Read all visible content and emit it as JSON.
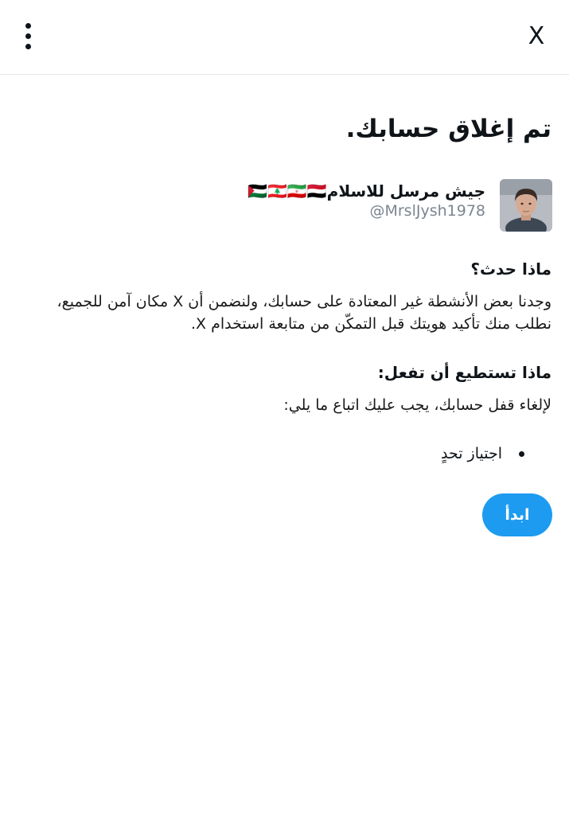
{
  "header": {
    "menu_icon": "more-vertical-icon",
    "close_icon": "close-x-icon",
    "close_label": "X"
  },
  "main": {
    "title": "تم إغلاق حسابك.",
    "account": {
      "display_name": "جيش مرسل للاسلام🇵🇸🇱🇧🇮🇷🇾🇪",
      "handle": "@MrslJysh1978"
    },
    "what_happened": {
      "heading": "ماذا حدث؟",
      "body": "وجدنا بعض الأنشطة غير المعتادة على حسابك، ولنضمن أن X مكان آمن للجميع، نطلب منك تأكيد هويتك قبل التمكّن من متابعة استخدام X."
    },
    "what_you_can_do": {
      "heading": "ماذا تستطيع أن تفعل:",
      "body": "لإلغاء قفل حسابك، يجب عليك اتباع ما يلي:",
      "steps": [
        "اجتياز تحدٍ"
      ]
    },
    "start_button": "ابدأ"
  },
  "colors": {
    "accent": "#1d9bf0",
    "text": "#0f1419",
    "muted": "#7b8690",
    "divider": "#e6e6e6"
  }
}
